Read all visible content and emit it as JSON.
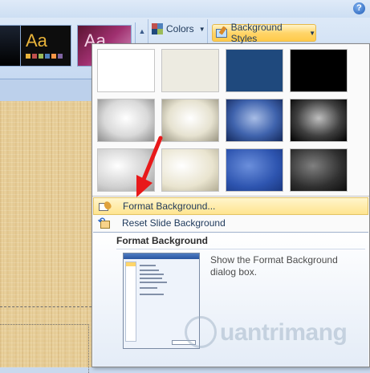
{
  "ribbon": {
    "help_glyph": "?",
    "theme_thumbs": [
      {
        "label": "Aa"
      },
      {
        "label": "Aa"
      }
    ],
    "colors_label": "Colors",
    "background_styles_label": "Background Styles"
  },
  "menu": {
    "format_background_label": "Format Background...",
    "reset_background_label": "Reset Slide Background"
  },
  "swatches": [
    {
      "color": "#ffffff"
    },
    {
      "color": "#edebe1"
    },
    {
      "color": "#1f497d"
    },
    {
      "color": "#000000"
    },
    {
      "color": "gradient-gray-light"
    },
    {
      "color": "gradient-tan"
    },
    {
      "color": "gradient-blue"
    },
    {
      "color": "gradient-black"
    },
    {
      "color": "radial-gray-light"
    },
    {
      "color": "radial-tan"
    },
    {
      "color": "radial-blue"
    },
    {
      "color": "radial-black"
    }
  ],
  "tooltip": {
    "title": "Format Background",
    "description": "Show the Format Background dialog box."
  },
  "watermark": {
    "text": "uantrimang"
  },
  "colors": {
    "menu_hover": "#ffe48f",
    "accent_red": "#e8191a",
    "ribbon_blue": "#c6d9f1"
  }
}
